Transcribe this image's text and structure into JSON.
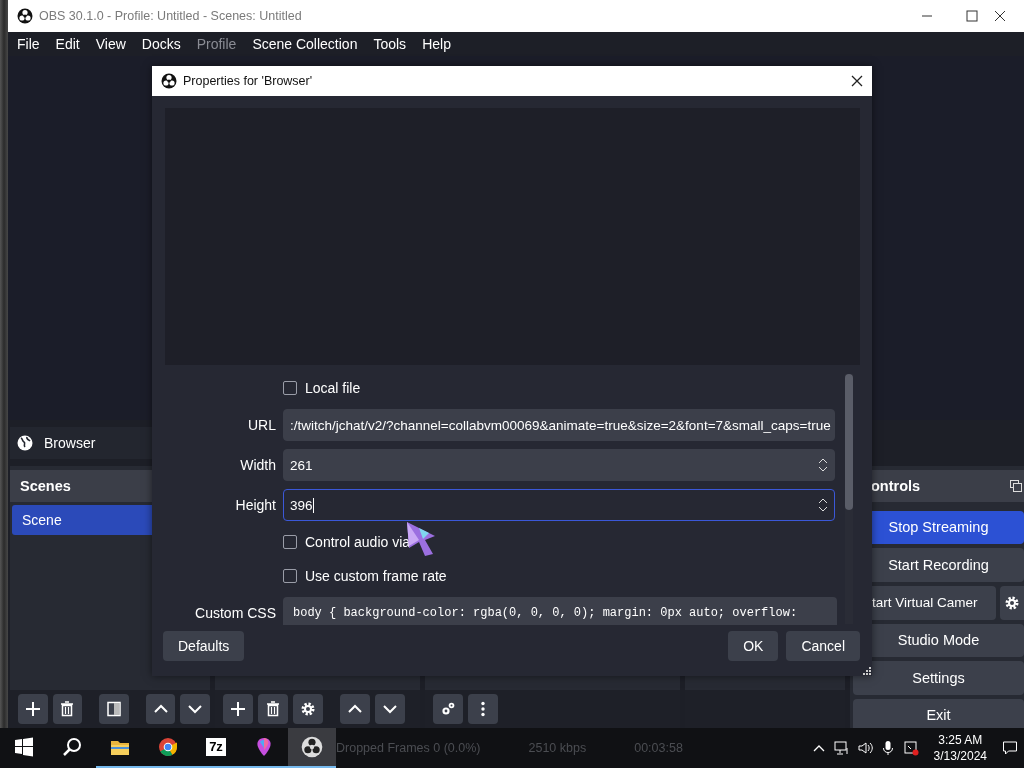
{
  "window": {
    "title": "OBS 30.1.0 - Profile: Untitled - Scenes: Untitled"
  },
  "menu": [
    {
      "label": "File",
      "disabled": false
    },
    {
      "label": "Edit",
      "disabled": false
    },
    {
      "label": "View",
      "disabled": false
    },
    {
      "label": "Docks",
      "disabled": false
    },
    {
      "label": "Profile",
      "disabled": true
    },
    {
      "label": "Scene Collection",
      "disabled": false
    },
    {
      "label": "Tools",
      "disabled": false
    },
    {
      "label": "Help",
      "disabled": false
    }
  ],
  "context_bar": {
    "source": "Browser"
  },
  "scenes_dock": {
    "title": "Scenes",
    "items": [
      {
        "label": "Scene",
        "selected": true
      }
    ]
  },
  "controls_dock": {
    "title": "ontrols",
    "buttons": [
      {
        "label": "Stop Streaming",
        "active": true,
        "kind": "button"
      },
      {
        "label": "Start Recording",
        "active": false,
        "kind": "button"
      },
      {
        "label": "tart Virtual Camer",
        "active": false,
        "kind": "split"
      },
      {
        "label": "Studio Mode",
        "active": false,
        "kind": "button"
      },
      {
        "label": "Settings",
        "active": false,
        "kind": "button"
      },
      {
        "label": "Exit",
        "active": false,
        "kind": "button"
      }
    ]
  },
  "dialog": {
    "title": "Properties for 'Browser'",
    "fields": [
      {
        "kind": "checkbox",
        "label": "Local file",
        "checked": false
      },
      {
        "kind": "text",
        "label": "URL",
        "value": ":/twitch/jchat/v2/?channel=collabvm00069&animate=true&size=2&font=7&small_caps=true"
      },
      {
        "kind": "spin",
        "label": "Width",
        "value": "261",
        "focused": false
      },
      {
        "kind": "spin",
        "label": "Height",
        "value": "396",
        "focused": true
      },
      {
        "kind": "checkbox",
        "label": "Control audio via",
        "checked": false
      },
      {
        "kind": "checkbox",
        "label": "Use custom frame rate",
        "checked": false
      },
      {
        "kind": "textarea",
        "label": "Custom CSS",
        "value": "body { background-color: rgba(0, 0, 0, 0); margin: 0px auto; overflow:"
      }
    ],
    "buttons_left": [
      "Defaults"
    ],
    "buttons_right": [
      "OK",
      "Cancel"
    ]
  },
  "status_bar": [
    "Dropped Frames 0 (0.0%)",
    "2510 kbps",
    "00:03:58"
  ],
  "taskbar": {
    "apps": [
      {
        "kind": "folder",
        "running": true,
        "active": false
      },
      {
        "kind": "browser",
        "running": true,
        "active": false
      },
      {
        "kind": "archiver",
        "label": "7z",
        "running": true,
        "active": false
      },
      {
        "kind": "paint",
        "running": true,
        "active": false
      },
      {
        "kind": "obs",
        "running": true,
        "active": true
      }
    ],
    "time": "3:25 AM",
    "date": "3/13/2024"
  }
}
